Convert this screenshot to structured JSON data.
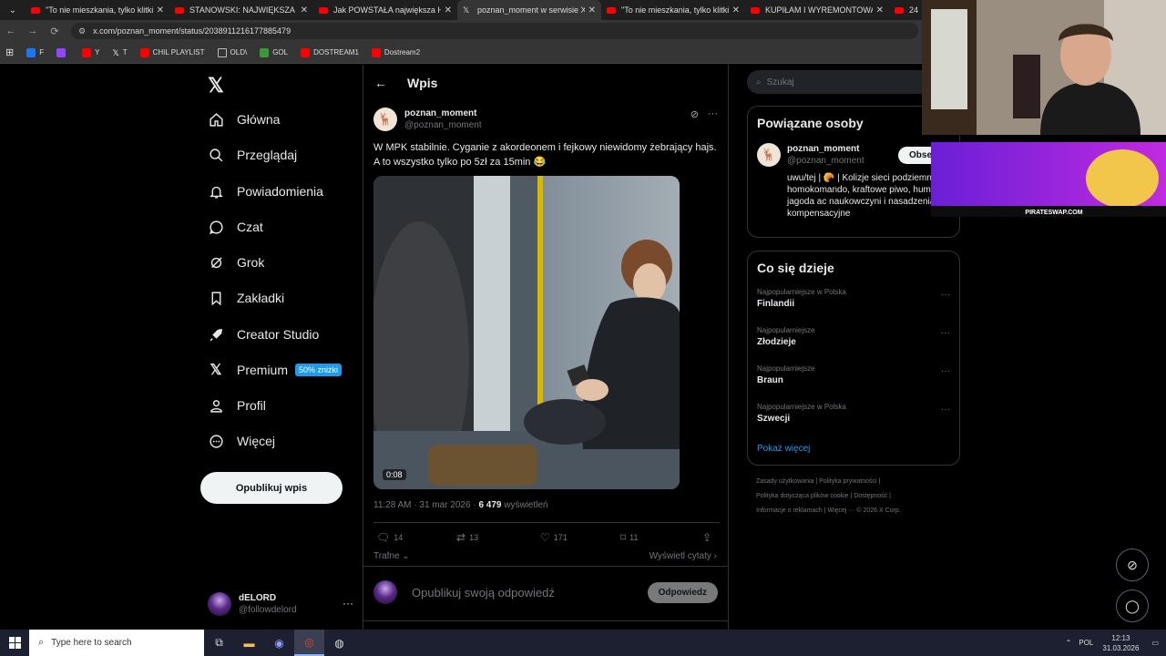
{
  "browser": {
    "tabs": [
      {
        "label": "\"To nie mieszkania, tylko klitki\"",
        "kind": "youtube",
        "active": false
      },
      {
        "label": "STANOWSKI: NAJWIĘKSZA FAB",
        "kind": "youtube",
        "active": false
      },
      {
        "label": "Jak POWSTAŁA największa HIP",
        "kind": "youtube",
        "active": false
      },
      {
        "label": "poznan_moment w serwisie X:",
        "kind": "x",
        "active": true
      },
      {
        "label": "\"To nie mieszkania, tylko klitki\"",
        "kind": "youtube",
        "active": false
      },
      {
        "label": "KUPIŁAM I WYREMONTOWAŁ",
        "kind": "youtube",
        "active": false
      },
      {
        "label": "24",
        "kind": "youtube",
        "active": false
      }
    ],
    "url": "x.com/poznan_moment/status/2038911216177885479",
    "bookmarks": [
      {
        "label": "F",
        "icon": "facebook-icon",
        "color": "#1877f2"
      },
      {
        "label": "",
        "icon": "twitch-icon",
        "color": "#9146ff"
      },
      {
        "label": "Y",
        "icon": "youtube-icon",
        "color": "#ff0000"
      },
      {
        "label": "T",
        "icon": "x-icon",
        "color": "#ffffff"
      },
      {
        "label": "CHIL PLAYLIST",
        "icon": "youtube-icon",
        "color": "#ff0000"
      },
      {
        "label": "OLD\\",
        "icon": "folder-icon",
        "color": "#bbbbbb"
      },
      {
        "label": "GOL",
        "icon": "gol-icon",
        "color": "#3a9a3a"
      },
      {
        "label": "DOSTREAM1",
        "icon": "youtube-icon",
        "color": "#ff0000"
      },
      {
        "label": "Dostream2",
        "icon": "youtube-icon",
        "color": "#ff0000"
      }
    ]
  },
  "sidebar": {
    "items": [
      {
        "label": "Główna",
        "icon": "home-icon"
      },
      {
        "label": "Przeglądaj",
        "icon": "search-icon"
      },
      {
        "label": "Powiadomienia",
        "icon": "bell-icon"
      },
      {
        "label": "Czat",
        "icon": "chat-icon"
      },
      {
        "label": "Grok",
        "icon": "grok-icon"
      },
      {
        "label": "Zakładki",
        "icon": "bookmark-icon"
      },
      {
        "label": "Creator Studio",
        "icon": "rocket-icon"
      },
      {
        "label": "Premium",
        "icon": "x-icon",
        "badge": "50% zniżki"
      },
      {
        "label": "Profil",
        "icon": "person-icon"
      },
      {
        "label": "Więcej",
        "icon": "more-circle-icon"
      }
    ],
    "publish_label": "Opublikuj wpis",
    "account": {
      "name": "dELORD",
      "handle": "@followdelord"
    }
  },
  "post": {
    "header_title": "Wpis",
    "author_name": "poznan_moment",
    "author_handle": "@poznan_moment",
    "text": "W MPK stabilnie. Cyganie z akordeonem i fejkowy niewidomy żebrający hajs. A to wszystko tylko po 5zł za 15min 😂",
    "video_duration": "0:08",
    "time": "11:28 AM · 31 mar 2026 · ",
    "views_count": "6 479",
    "views_label": " wyświetleń",
    "replies": "14",
    "reposts": "13",
    "likes": "171",
    "bookmarks": "11",
    "sort_label": "Trafne",
    "view_quotes": "Wyświetl cytaty",
    "reply_placeholder": "Opublikuj swoją odpowiedź",
    "reply_button": "Odpowiedz"
  },
  "right": {
    "search_placeholder": "Szukaj",
    "related_title": "Powiązane osoby",
    "related": {
      "name": "poznan_moment",
      "handle": "@poznan_moment",
      "follow": "Obserw",
      "bio": "uwu/tej | 🥐 | Kolizje sieci podziemnych, homokomando, kraftowe piwo, hummus, jagoda ac naukowczyni i nasadzenia kompensacyjne"
    },
    "trends_title": "Co się dzieje",
    "trends": [
      {
        "context": "Najpopularniejsze w Polska",
        "topic": "Finlandii"
      },
      {
        "context": "Najpopularniejsze",
        "topic": "Złodzieje"
      },
      {
        "context": "Najpopularniejsze",
        "topic": "Braun"
      },
      {
        "context": "Najpopularniejsze w Polska",
        "topic": "Szwecji"
      }
    ],
    "show_more": "Pokaż więcej",
    "footer_line1": "Zasady użytkowania  |  Polityka prywatności  |",
    "footer_line2": "Polityka dotycząca plików cookie  |  Dostępność  |",
    "footer_line3": "Informacje o reklamach  |  Więcej ···  © 2026 X Corp."
  },
  "overlay": {
    "promo_text": "PIRATESWAP.COM"
  },
  "taskbar": {
    "search_placeholder": "Type here to search",
    "lang": "POL",
    "time": "12:13",
    "date": "31.03.2026"
  },
  "colors": {
    "accent": "#1d9bf0",
    "background": "#000000",
    "border": "#2f3336",
    "muted": "#71767b"
  }
}
